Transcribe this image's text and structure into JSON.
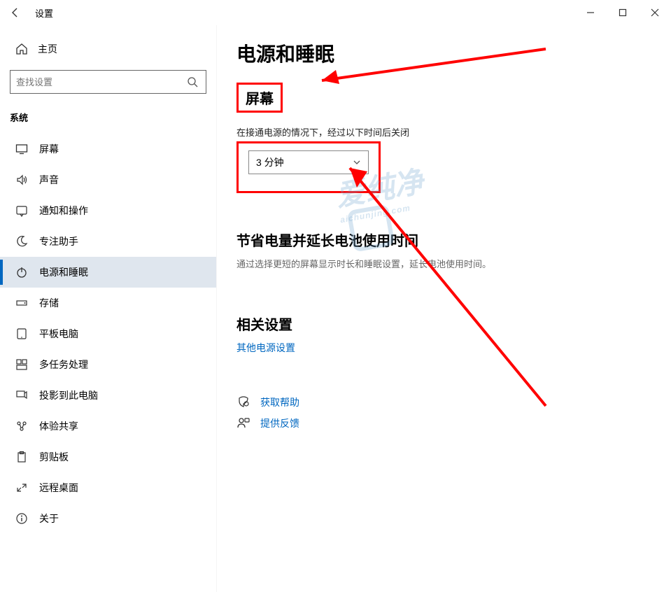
{
  "titlebar": {
    "title": "设置"
  },
  "sidebar": {
    "home": "主页",
    "search_placeholder": "查找设置",
    "category": "系统",
    "items": [
      {
        "label": "屏幕"
      },
      {
        "label": "声音"
      },
      {
        "label": "通知和操作"
      },
      {
        "label": "专注助手"
      },
      {
        "label": "电源和睡眠"
      },
      {
        "label": "存储"
      },
      {
        "label": "平板电脑"
      },
      {
        "label": "多任务处理"
      },
      {
        "label": "投影到此电脑"
      },
      {
        "label": "体验共享"
      },
      {
        "label": "剪贴板"
      },
      {
        "label": "远程桌面"
      },
      {
        "label": "关于"
      }
    ]
  },
  "content": {
    "page_title": "电源和睡眠",
    "section_screen": "屏幕",
    "screen_desc": "在接通电源的情况下，经过以下时间后关闭",
    "screen_value": "3 分钟",
    "battery_title": "节省电量并延长电池使用时间",
    "battery_desc": "通过选择更短的屏幕显示时长和睡眠设置，延长电池使用时间。",
    "related_title": "相关设置",
    "related_link": "其他电源设置",
    "help": "获取帮助",
    "feedback": "提供反馈"
  }
}
